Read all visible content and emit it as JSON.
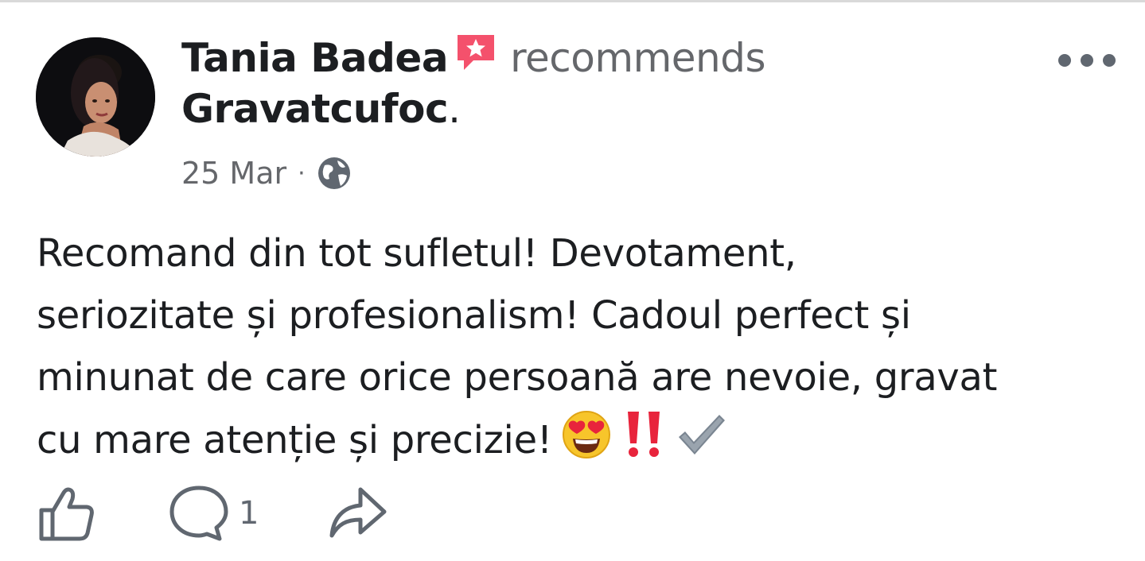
{
  "post": {
    "author": {
      "name": "Tania Badea",
      "avatar_alt": "profile photo"
    },
    "action_text": "recommends",
    "page_name": "Gravatcufoc",
    "period": ".",
    "recommend_icon": "recommend-badge-icon",
    "time": "25 Mar",
    "separator": "·",
    "privacy_icon": "globe-icon",
    "body_lines": [
      "Recomand din tot sufletul! Devotament,",
      "seriozitate și profesionalism! Cadoul perfect și",
      "minunat de care orice persoană are nevoie, gravat",
      "cu mare atenție și precizie!"
    ],
    "emojis": [
      "heart-eyes-emoji",
      "double-exclamation-emoji",
      "check-mark-emoji"
    ],
    "comment_count": "1"
  },
  "actions": {
    "like_icon": "thumbs-up-icon",
    "comment_icon": "comment-icon",
    "share_icon": "share-icon",
    "more_icon": "more-options-icon"
  },
  "colors": {
    "text_primary": "#1c1e21",
    "text_secondary": "#65676b",
    "badge_red": "#f3425f",
    "icon_gray": "#606770"
  }
}
